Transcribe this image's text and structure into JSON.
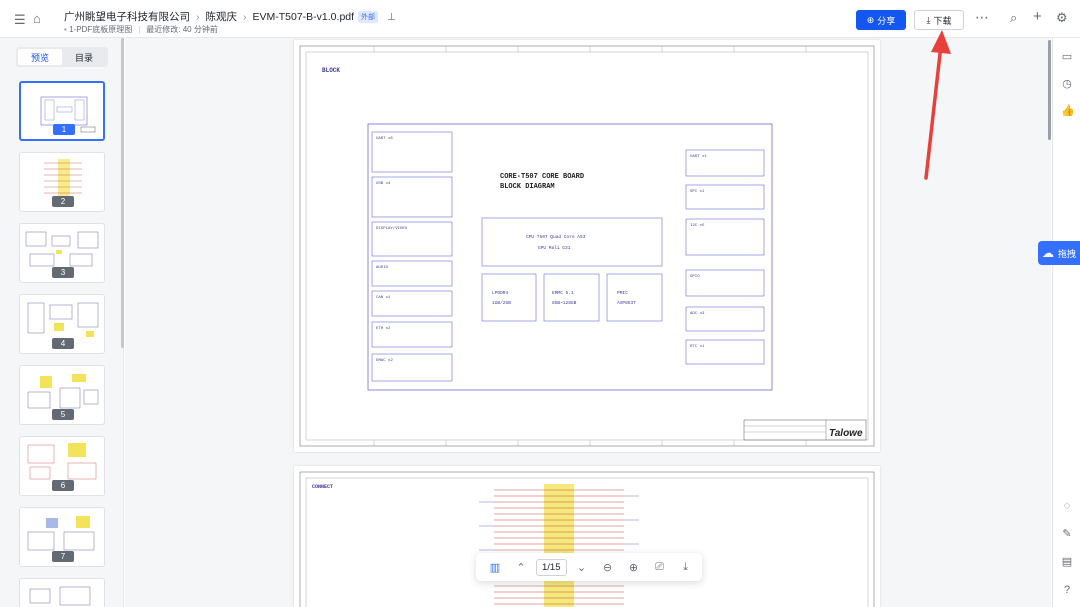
{
  "topbar": {
    "breadcrumbs": [
      "广州眺望电子科技有限公司",
      "陈观庆",
      "EVM-T507-B-v1.0.pdf"
    ],
    "external_tag": "外部",
    "pin_icon": "pin-icon",
    "folder": "1-PDF底板原理图",
    "modified": "最近修改: 40 分钟前",
    "share_label": "分享",
    "download_label": "下载"
  },
  "sidebar": {
    "tabs": [
      "预览",
      "目录"
    ],
    "active_tab": "预览",
    "pages": [
      "1",
      "2",
      "3",
      "4",
      "5",
      "6",
      "7"
    ],
    "active_page": "1"
  },
  "doc": {
    "page1": {
      "section_label": "BLOCK",
      "title_line1": "CORE-T507 CORE BOARD",
      "title_line2": "BLOCK DIAGRAM",
      "cpu_line1": "CPU T507 Quad Core A53",
      "cpu_line2": "GPU Mali G31",
      "mem1_line1": "LPDDR4",
      "mem1_line2": "1GB/2GB",
      "mem2_line1": "EMMC 5.1",
      "mem2_line2": "8GB~128GB",
      "pmu_line1": "PMIC",
      "pmu_line2": "AXP853T",
      "left_blocks": [
        "UART x6",
        "USB x4",
        "DISPLAY/VIDEO",
        "AUDIO",
        "CAN x1",
        "ETH x2",
        "EMAC x2"
      ],
      "right_blocks": [
        "UART x1",
        "SPI x1",
        "I2C x5",
        "GPIO",
        "ADC x3",
        "RTC x1"
      ],
      "logo": "Talowe"
    },
    "page2": {
      "section_label": "CONNECT"
    }
  },
  "viewer_toolbar": {
    "page_indicator": "1/15"
  },
  "ai_panel": {
    "label": "拖拽"
  }
}
